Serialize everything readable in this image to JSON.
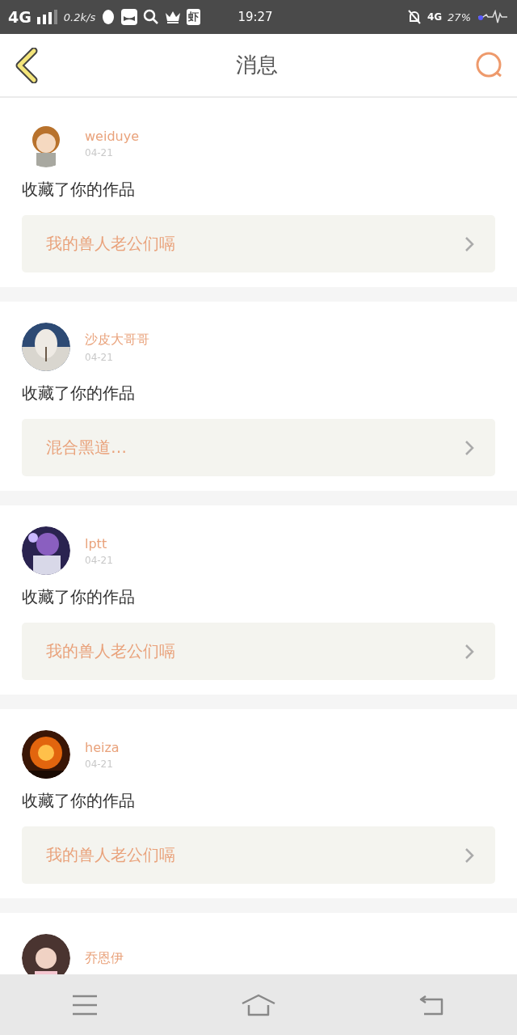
{
  "status_bar": {
    "network": "4G",
    "speed": "0.2k/s",
    "app_badge": "虾",
    "time": "19:27",
    "network_right": "4G",
    "battery": "27%"
  },
  "header": {
    "title": "消息"
  },
  "messages": [
    {
      "user": "weiduye",
      "date": "04-21",
      "action": "收藏了你的作品",
      "work": "我的兽人老公们嗝"
    },
    {
      "user": "沙皮大哥哥",
      "date": "04-21",
      "action": "收藏了你的作品",
      "work": "混合黑道…"
    },
    {
      "user": "lptt",
      "date": "04-21",
      "action": "收藏了你的作品",
      "work": "我的兽人老公们嗝"
    },
    {
      "user": "heiza",
      "date": "04-21",
      "action": "收藏了你的作品",
      "work": "我的兽人老公们嗝"
    },
    {
      "user": "乔恩伊"
    }
  ]
}
